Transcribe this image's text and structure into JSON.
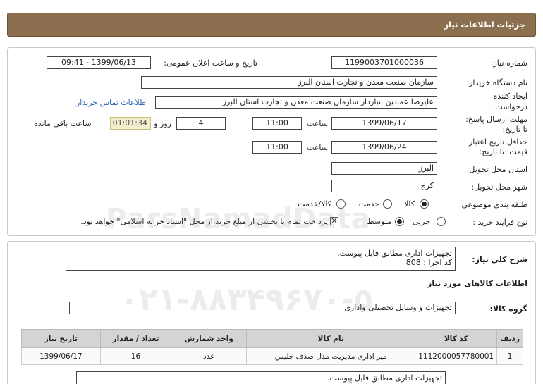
{
  "header": {
    "title": "جزئیات اطلاعات نیاز"
  },
  "form": {
    "need_number_label": "شماره نیاز:",
    "need_number": "1199003701000036",
    "announce_label": "تاریخ و ساعت اعلان عمومی:",
    "announce_value": "1399/06/13 - 09:41",
    "buyer_org_label": "نام دستگاه خریدار:",
    "buyer_org": "سازمان صنعت معدن و تجارت استان البرز",
    "creator_label_1": "ایجاد کننده",
    "creator_label_2": "درخواست:",
    "creator": "علیرضا عمادین انباردار سازمان صنعت معدن و تجارت استان البرز",
    "contact_link": "اطلاعات تماس خریدار",
    "deadline_label_1": "مهلت ارسال پاسخ:",
    "deadline_label_2": "تا تاریخ:",
    "deadline_date": "1399/06/17",
    "time_label": "ساعت",
    "deadline_time": "11:00",
    "days_value": "4",
    "days_label": "روز و",
    "remaining_timer": "01:01:34",
    "remaining_label": "ساعت باقی مانده",
    "validity_label_1": "حداقل تاریخ اعتبار",
    "validity_label_2": "قیمت: تا تاریخ:",
    "validity_date": "1399/06/24",
    "validity_time": "11:00",
    "province_label": "استان محل تحویل:",
    "province": "البرز",
    "city_label": "شهر محل تحویل:",
    "city": "کرج",
    "category_label": "طبقه بندی موضوعی:",
    "category_options": [
      "کالا",
      "خدمت",
      "کالا/خدمت"
    ],
    "purchase_type_label": "نوع فرآیند خرید :",
    "purchase_options": [
      "جزیی",
      "متوسط"
    ],
    "payment_note": "پرداخت تمام یا بخشی از مبلغ خرید،از محل \"اسناد خزانه اسلامی\" خواهد بود."
  },
  "details": {
    "summary_label": "شرح کلی نیاز:",
    "summary_line1": "تجهیزات اداری مطابق فایل پیوست.",
    "summary_line2": "کد اجرا : 808",
    "goods_info_title": "اطلاعات کالاهای مورد نیاز",
    "goods_group_label": "گروه کالا:",
    "goods_group": "تجهیزات و وسایل تحصیلی واداری",
    "table": {
      "headers": [
        "ردیف",
        "کد کالا",
        "نام کالا",
        "واحد شمارش",
        "تعداد / مقدار",
        "تاریخ نیاز"
      ],
      "rows": [
        [
          "1",
          "1112000057780001",
          "میز اداری مدیریت مدل صدف جلیس",
          "عدد",
          "16",
          "1399/06/17"
        ]
      ]
    },
    "note": "تجهیزات اداری مطابق فایل پیوست."
  },
  "watermark": {
    "line1": "ParsNamadData",
    "line2": "۰۲۱-۸۸۳۴۹۶۷۰-۵"
  },
  "colors": {
    "header_bg": "#8c6f4f",
    "link": "#2a63b5",
    "timer_bg": "#f2efcf"
  }
}
